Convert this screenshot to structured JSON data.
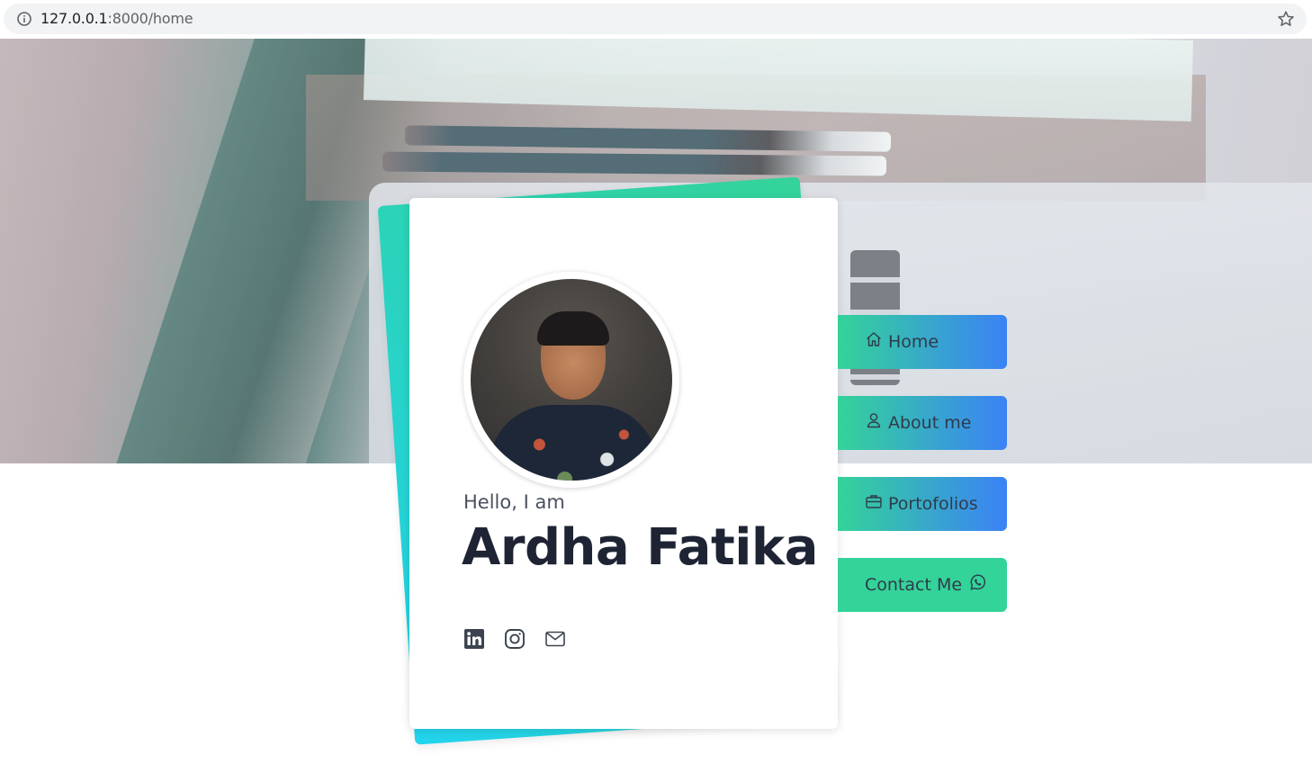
{
  "browser": {
    "url_host": "127.0.0.1",
    "url_rest": ":8000/home"
  },
  "profile": {
    "greeting": "Hello, I am",
    "name": "Ardha Fatika",
    "socials": [
      "linkedin-icon",
      "instagram-icon",
      "mail-icon"
    ]
  },
  "menu": {
    "items": [
      {
        "label": "Home",
        "icon": "home-icon"
      },
      {
        "label": "About me",
        "icon": "user-icon"
      },
      {
        "label": "Portofolios",
        "icon": "briefcase-icon"
      },
      {
        "label": "Contact Me",
        "icon": "whatsapp-icon"
      }
    ]
  },
  "colors": {
    "accent_green": "#34d399",
    "accent_blue": "#3b82f6",
    "accent_cyan": "#22d3ee",
    "text_dark": "#1e2433"
  }
}
